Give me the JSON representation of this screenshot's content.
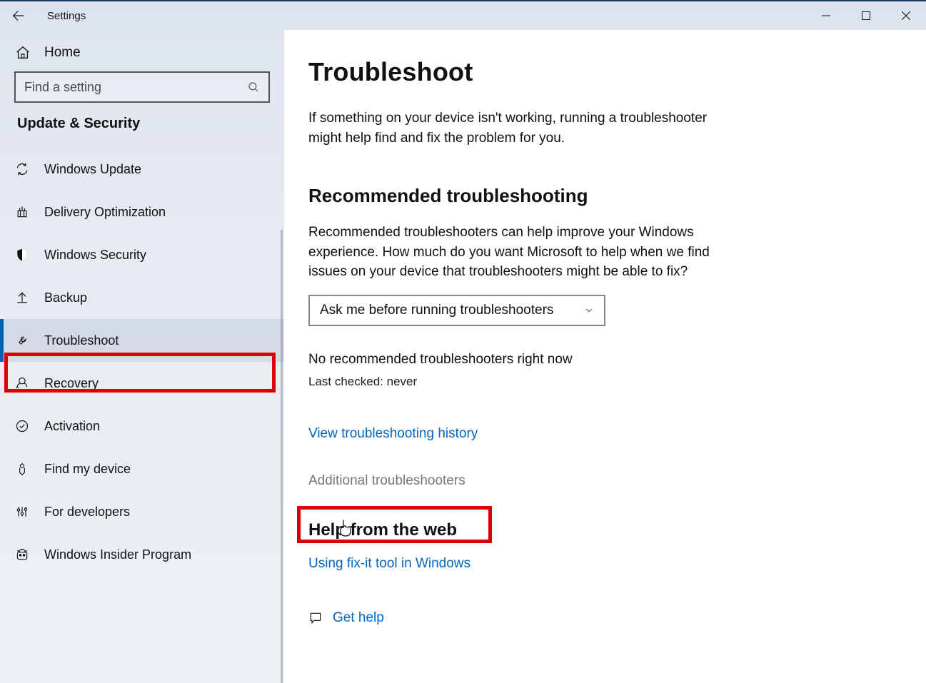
{
  "window": {
    "title": "Settings"
  },
  "sidebar": {
    "home": "Home",
    "search_placeholder": "Find a setting",
    "section": "Update & Security",
    "items": [
      {
        "icon": "sync-icon",
        "label": "Windows Update"
      },
      {
        "icon": "optimization-icon",
        "label": "Delivery Optimization"
      },
      {
        "icon": "shield-icon",
        "label": "Windows Security"
      },
      {
        "icon": "backup-icon",
        "label": "Backup"
      },
      {
        "icon": "wrench-icon",
        "label": "Troubleshoot"
      },
      {
        "icon": "recovery-icon",
        "label": "Recovery"
      },
      {
        "icon": "activation-icon",
        "label": "Activation"
      },
      {
        "icon": "location-icon",
        "label": "Find my device"
      },
      {
        "icon": "developer-icon",
        "label": "For developers"
      },
      {
        "icon": "insider-icon",
        "label": "Windows Insider Program"
      }
    ],
    "selected_index": 4
  },
  "main": {
    "title": "Troubleshoot",
    "lead": "If something on your device isn't working, running a troubleshooter might help find and fix the problem for you.",
    "recommended": {
      "heading": "Recommended troubleshooting",
      "description": "Recommended troubleshooters can help improve your Windows experience. How much do you want Microsoft to help when we find issues on your device that troubleshooters might be able to fix?",
      "select_value": "Ask me before running troubleshooters",
      "status": "No recommended troubleshooters right now",
      "last_checked": "Last checked: never",
      "history_link": "View troubleshooting history",
      "additional_link": "Additional troubleshooters"
    },
    "help": {
      "heading": "Help from the web",
      "link": "Using fix-it tool in Windows",
      "get_help": "Get help"
    }
  }
}
